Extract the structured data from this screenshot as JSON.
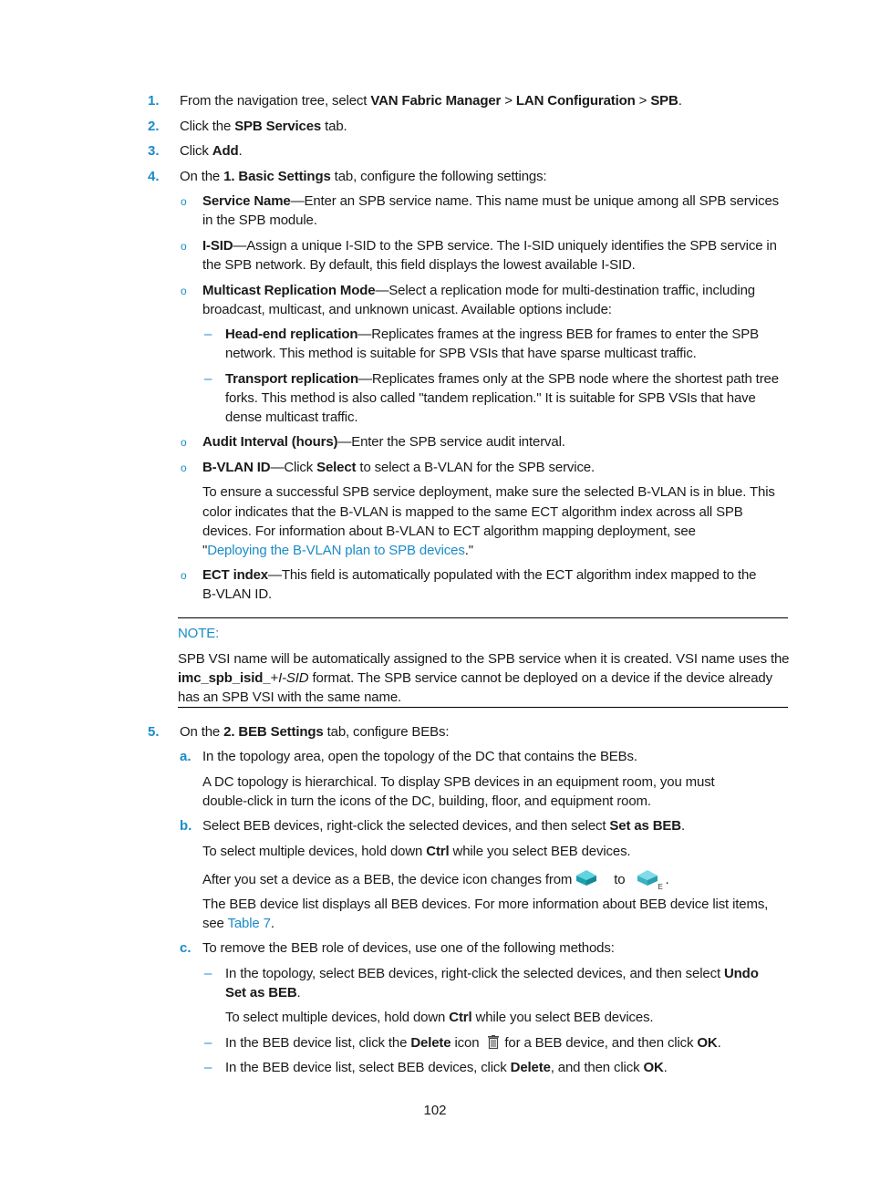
{
  "steps": [
    {
      "num": "1.",
      "pre": "From the navigation tree, select ",
      "b1": "VAN Fabric Manager",
      "m1": " > ",
      "b2": "LAN Configuration",
      "m2": " > ",
      "b3": "SPB",
      "post": "."
    },
    {
      "num": "2.",
      "pre": "Click the ",
      "b1": "SPB Services",
      "post": " tab."
    },
    {
      "num": "3.",
      "pre": "Click ",
      "b1": "Add",
      "post": "."
    },
    {
      "num": "4.",
      "pre": "On the ",
      "b1": "1. Basic Settings",
      "post": " tab, configure the following settings:"
    },
    {
      "num": "5.",
      "pre": "On the ",
      "b1": "2. BEB Settings",
      "post": " tab, configure BEBs:"
    }
  ],
  "settings": {
    "service_name": {
      "label": "Service Name",
      "l1": "—Enter an SPB service name. This name must be unique among all SPB services",
      "l2": "in the SPB module."
    },
    "isid": {
      "label": "I-SID",
      "l1": "—Assign a unique I-SID to the SPB service. The I-SID uniquely identifies the SPB service in",
      "l2": "the SPB network. By default, this field displays the lowest available I-SID."
    },
    "mrm": {
      "label": "Multicast Replication Mode",
      "l1": "—Select a replication mode for multi-destination traffic, including",
      "l2": "broadcast, multicast, and unknown unicast. Available options include:"
    },
    "head_end": {
      "label": "Head-end replication",
      "l1": "—Replicates frames at the ingress BEB for frames to enter the SPB",
      "l2": "network. This method is suitable for SPB VSIs that have sparse multicast traffic."
    },
    "transport": {
      "label": "Transport replication",
      "l1": "—Replicates frames only at the SPB node where the shortest path tree",
      "l2": "forks. This method is also called \"tandem replication.\" It is suitable for SPB VSIs that have",
      "l3": "dense multicast traffic."
    },
    "audit": {
      "label": "Audit Interval (hours)",
      "l1": "—Enter the SPB service audit interval."
    },
    "bvlan": {
      "label": "B-VLAN ID",
      "pre": "—Click ",
      "b1": "Select",
      "post": " to select a B-VLAN for the SPB service.",
      "p1": "To ensure a successful SPB service deployment, make sure the selected B-VLAN is in blue. This",
      "p2": "color indicates that the B-VLAN is mapped to the same ECT algorithm index across all SPB",
      "p3": "devices. For information about B-VLAN to ECT algorithm mapping deployment, see",
      "q1": "\"",
      "link": "Deploying the B-VLAN plan to SPB devices",
      "q2": ".\""
    },
    "ect": {
      "label": "ECT index",
      "l1": "—This field is automatically populated with the ECT algorithm index mapped to the",
      "l2": "B-VLAN ID."
    }
  },
  "note": {
    "label": "NOTE:",
    "l1": "SPB VSI name will be automatically assigned to the SPB service when it is created. VSI name uses the",
    "b1": "imc_spb_isid_",
    "plus": "+",
    "i1": "I-SID",
    "l2post": " format. The SPB service cannot be deployed on a device if the device already",
    "l3": "has an SPB VSI with the same name."
  },
  "beb": {
    "a": {
      "letter": "a.",
      "l1": "In the topology area, open the topology of the DC that contains the BEBs.",
      "p1": "A DC topology is hierarchical. To display SPB devices in an equipment room, you must",
      "p2": "double-click in turn the icons of the DC, building, floor, and equipment room."
    },
    "b": {
      "letter": "b.",
      "pre": "Select BEB devices, right-click the selected devices, and then select ",
      "b1": "Set as BEB",
      "post": ".",
      "ctrl_pre": "To select multiple devices, hold down ",
      "ctrl": "Ctrl",
      "ctrl_post": " while you select BEB devices.",
      "icon_pre": "After you set a device as a BEB, the device icon changes from ",
      "icon_mid": " to ",
      "icon_post": ".",
      "beb_mark": "E",
      "list1": "The BEB device list displays all BEB devices. For more information about BEB device list items,",
      "list2pre": "see ",
      "table_link": "Table 7",
      "list2post": "."
    },
    "c": {
      "letter": "c.",
      "l1": "To remove the BEB role of devices, use one of the following methods:",
      "m1pre": "In the topology, select BEB devices, right-click the selected devices, and then select ",
      "m1b": "Undo",
      "m1b2": "Set as BEB",
      "m1post": ".",
      "ctrl_pre": "To select multiple devices, hold down ",
      "ctrl": "Ctrl",
      "ctrl_post": " while you select BEB devices.",
      "m2pre": "In the BEB device list, click the ",
      "m2b": "Delete",
      "m2mid": " icon",
      "m2post": "for a BEB device, and then click ",
      "m2ok": "OK",
      "m2end": ".",
      "m3pre": "In the BEB device list, select BEB devices, click ",
      "m3b": "Delete",
      "m3mid": ", and then click ",
      "m3ok": "OK",
      "m3end": "."
    }
  },
  "page_number": "102",
  "colors": {
    "accent": "#1a8cc8",
    "text": "#1a1a1a"
  }
}
